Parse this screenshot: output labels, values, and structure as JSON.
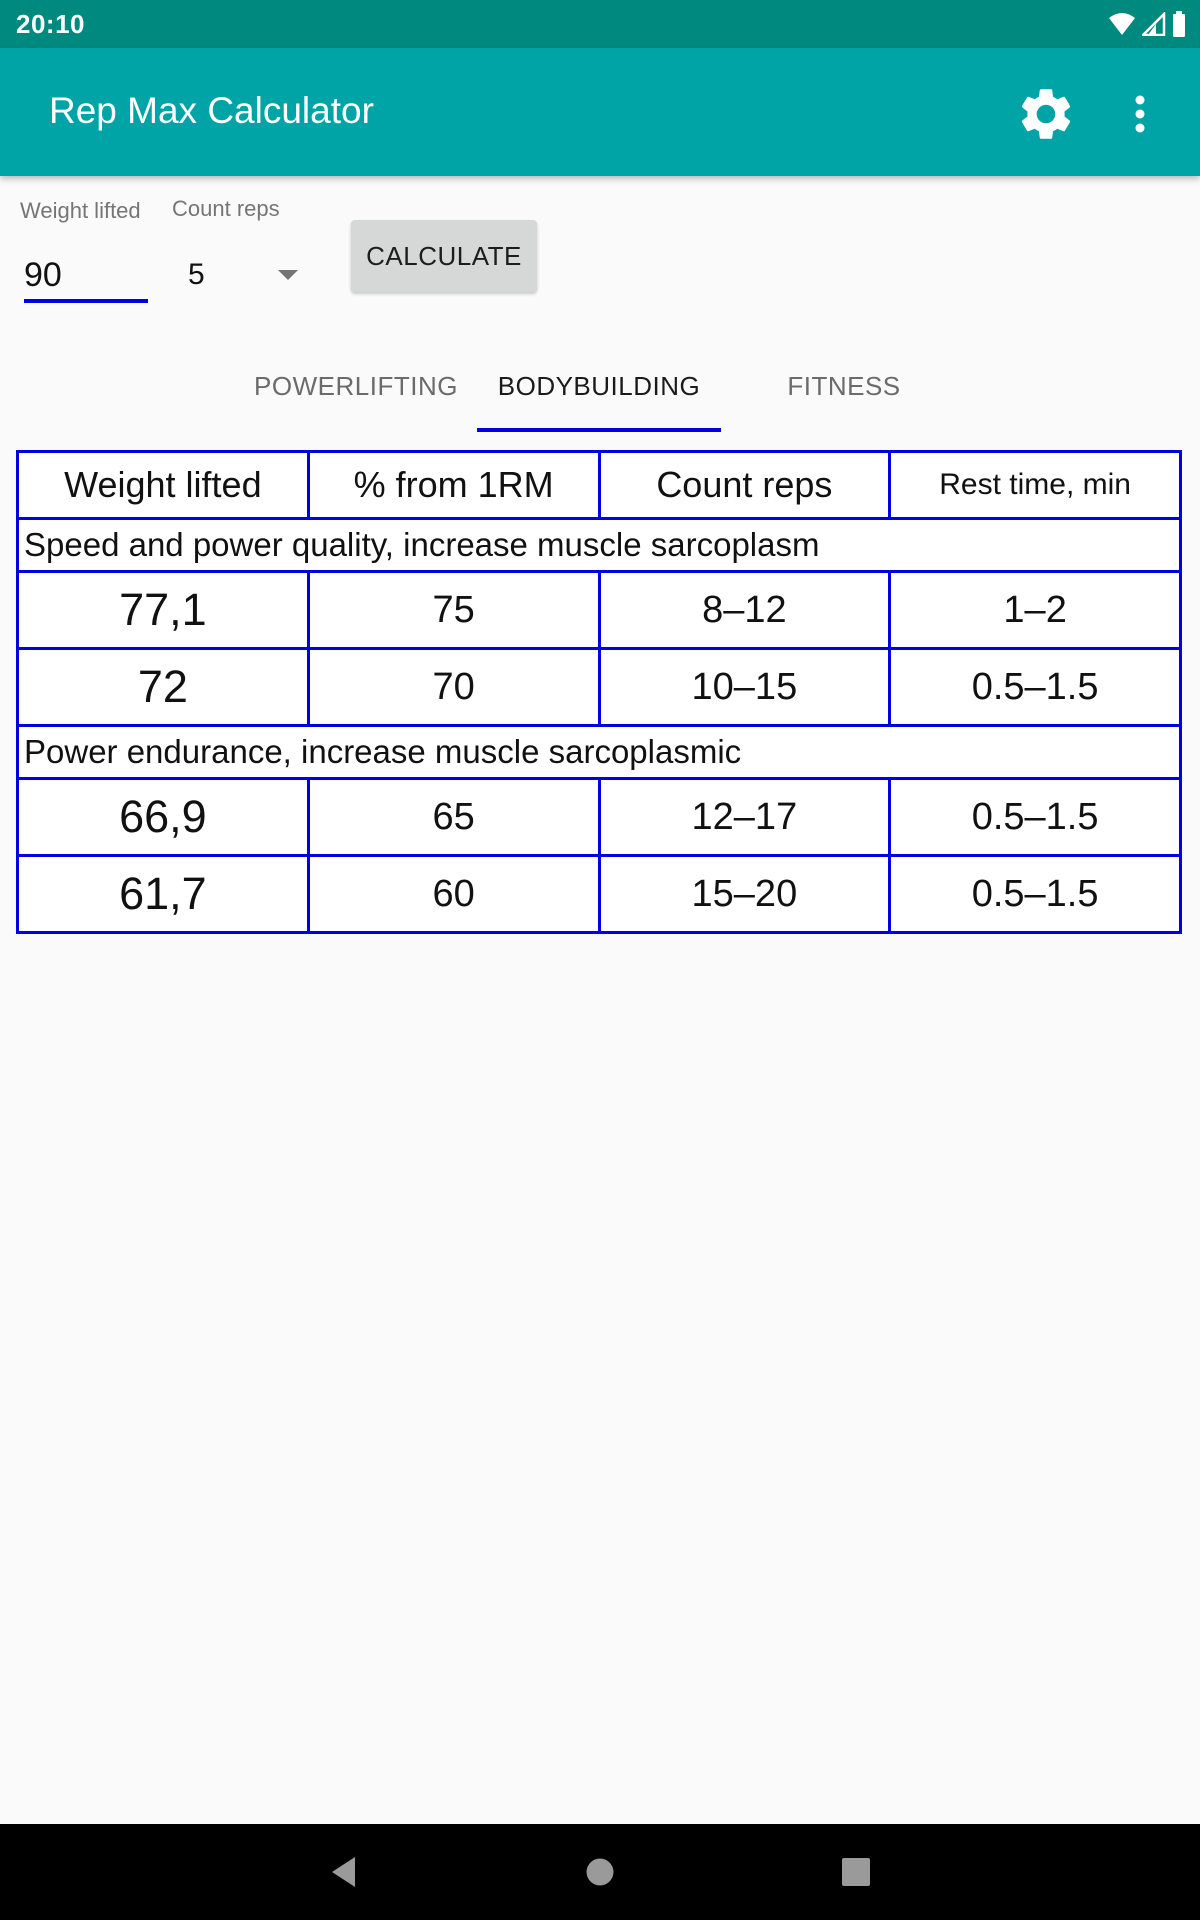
{
  "status_bar": {
    "time": "20:10",
    "icons": [
      "wifi-icon",
      "signal-icon",
      "battery-icon"
    ]
  },
  "app_bar": {
    "title": "Rep Max Calculator",
    "actions": [
      "gear-icon",
      "more-vert-icon"
    ]
  },
  "form": {
    "weight_label": "Weight lifted",
    "weight_value": "90",
    "reps_label": "Count reps",
    "reps_value": "5",
    "calculate_label": "CALCULATE"
  },
  "tabs": [
    {
      "label": "POWERLIFTING",
      "active": false
    },
    {
      "label": "BODYBUILDING",
      "active": true
    },
    {
      "label": "FITNESS",
      "active": false
    }
  ],
  "table": {
    "headers": [
      "Weight lifted",
      "% from 1RM",
      "Count reps",
      "Rest time, min"
    ],
    "groups": [
      {
        "title": "Speed and power quality, increase muscle sarcoplasm",
        "rows": [
          [
            "77,1",
            "75",
            "8–12",
            "1–2"
          ],
          [
            "72",
            "70",
            "10–15",
            "0.5–1.5"
          ]
        ]
      },
      {
        "title": "Power endurance, increase muscle sarcoplasmic",
        "rows": [
          [
            "66,9",
            "65",
            "12–17",
            "0.5–1.5"
          ],
          [
            "61,7",
            "60",
            "15–20",
            "0.5–1.5"
          ]
        ]
      }
    ]
  },
  "colors": {
    "status_bar": "#00897f",
    "app_bar": "#00a4a6",
    "accent": "#0000e0",
    "button_bg": "#d6d7d7"
  },
  "nav_bar": {
    "buttons": [
      "back-icon",
      "home-icon",
      "recents-icon"
    ]
  }
}
